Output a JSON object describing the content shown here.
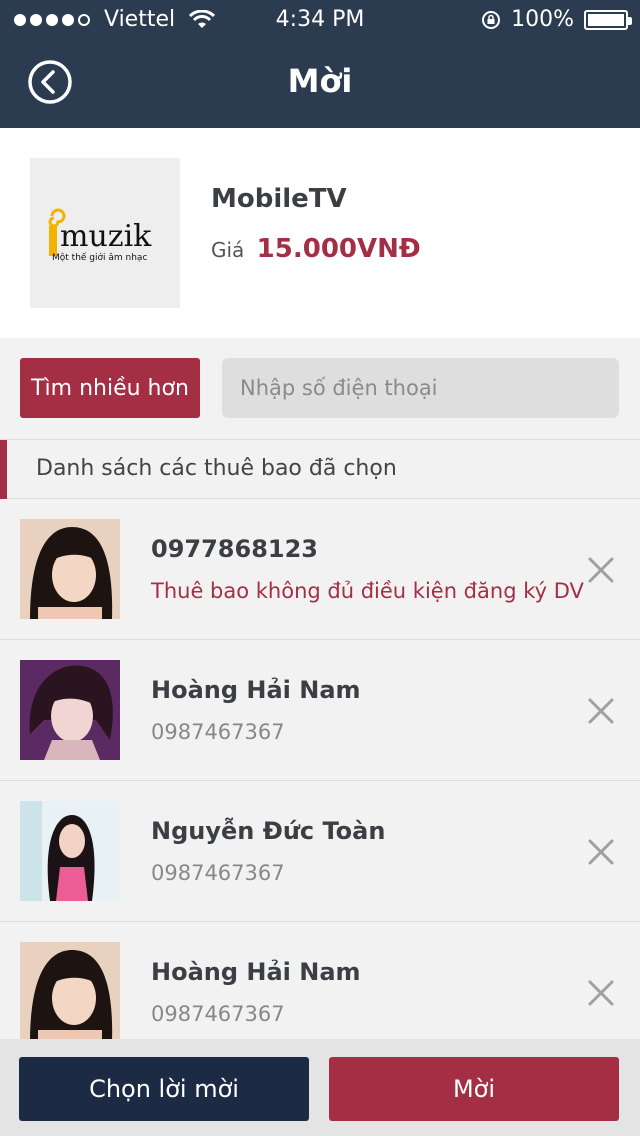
{
  "status": {
    "carrier": "Viettel",
    "time": "4:34 PM",
    "battery": "100%",
    "signal_bars": 4,
    "icons": [
      "signal-dots-icon",
      "wifi-icon",
      "rotation-lock-icon",
      "battery-icon"
    ]
  },
  "nav": {
    "title": "Mời",
    "back_icon": "back-chevron-icon"
  },
  "product": {
    "logo_text": "muzik",
    "logo_tagline": "Một thế giới âm nhạc",
    "name": "MobileTV",
    "price_label": "Giá",
    "price": "15.000VNĐ"
  },
  "search": {
    "more_label": "Tìm nhiều hơn",
    "phone_placeholder": "Nhập số điện thoại"
  },
  "section": {
    "title": "Danh sách các thuê bao đã chọn"
  },
  "subscribers": [
    {
      "name": "0977868123",
      "sub": "Thuê bao không đủ điều kiện đăng ký DV",
      "error": true
    },
    {
      "name": "Hoàng Hải Nam",
      "sub": "0987467367",
      "error": false
    },
    {
      "name": "Nguyễn Đức Toàn",
      "sub": "0987467367",
      "error": false
    },
    {
      "name": "Hoàng Hải Nam",
      "sub": "0987467367",
      "error": false
    }
  ],
  "actions": {
    "choose_label": "Chọn lời mời",
    "invite_label": "Mời"
  },
  "colors": {
    "header": "#2c3c50",
    "accent": "#a42f45",
    "dark_button": "#1c2a44"
  }
}
